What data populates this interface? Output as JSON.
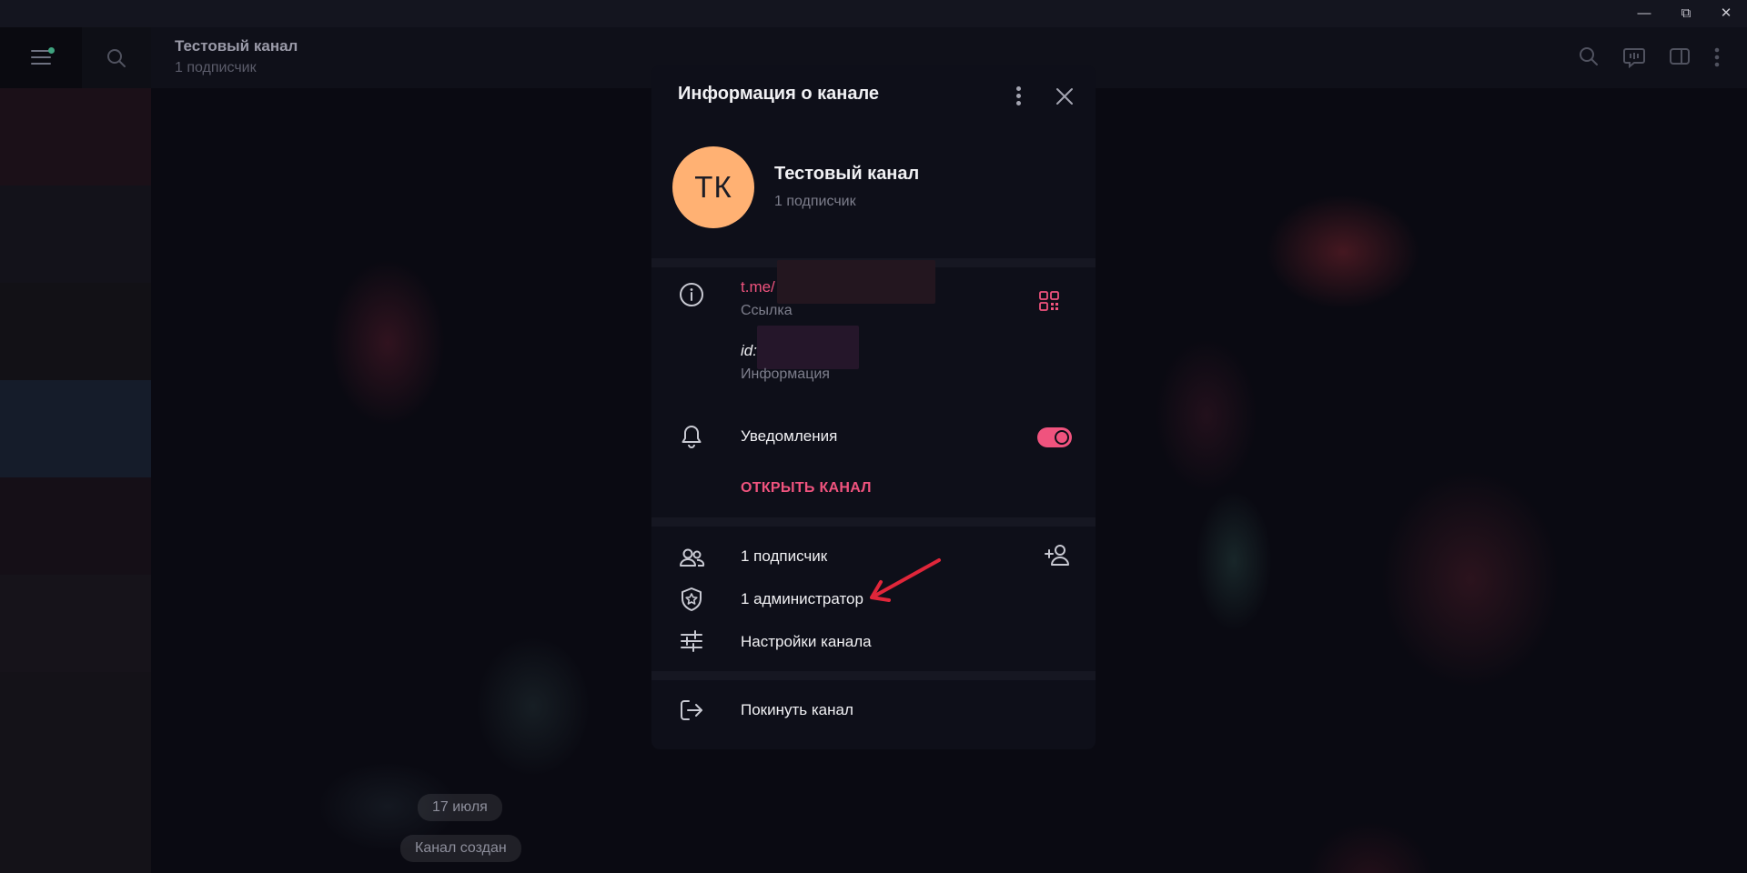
{
  "window": {
    "minimize_glyph": "—",
    "restore_glyph": "⧉",
    "close_glyph": "✕"
  },
  "header": {
    "title": "Тестовый канал",
    "subtitle": "1 подписчик",
    "icons": [
      "search-icon",
      "live-stream-icon",
      "sidebar-toggle-icon",
      "more-icon"
    ]
  },
  "chat": {
    "date_pill": "17 июля",
    "service_message": "Канал создан"
  },
  "modal": {
    "title": "Информация о канале",
    "avatar_initials": "ТК",
    "avatar_color": "#ffb173",
    "channel_name": "Тестовый канал",
    "channel_subscribers": "1 подписчик",
    "link_value": "t.me/",
    "link_label": "Ссылка",
    "id_value": "id:",
    "id_label": "Информация",
    "notifications_label": "Уведомления",
    "notifications_on": true,
    "open_channel_label": "ОТКРЫТЬ КАНАЛ",
    "subscribers_item": "1 подписчик",
    "admins_item": "1 администратор",
    "settings_item": "Настройки канала",
    "leave_item": "Покинуть канал"
  },
  "colors": {
    "accent": "#f0537e",
    "annotation_arrow": "#e0263a",
    "modal_bg": "#0e0f19"
  }
}
